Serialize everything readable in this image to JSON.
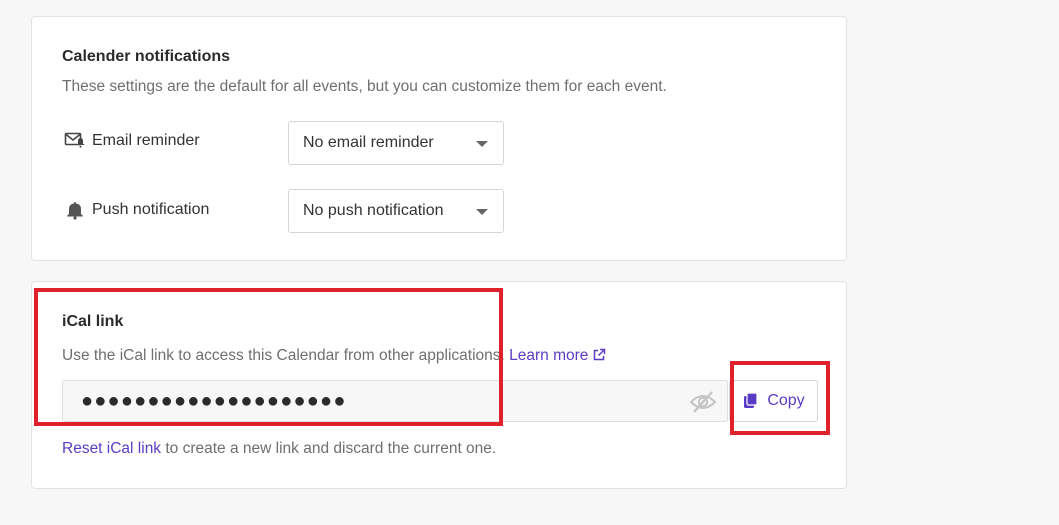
{
  "notifications": {
    "title": "Calender notifications",
    "description": "These settings are the default for all events, but you can customize them for each event.",
    "email": {
      "label": "Email reminder",
      "icon": "mail-bell-icon",
      "selected": "No email reminder"
    },
    "push": {
      "label": "Push notification",
      "icon": "bell-icon",
      "selected": "No push notification"
    }
  },
  "ical": {
    "title": "iCal link",
    "description": "Use the iCal link to access this Calendar from other applications.",
    "learn_more": "Learn more",
    "masked_value": "●●●●●●●●●●●●●●●●●●●●",
    "copy_label": "Copy",
    "reset_link": "Reset iCal link",
    "reset_suffix": " to create a new link and discard the current one."
  },
  "colors": {
    "accent": "#5b3cc4",
    "highlight": "#e0202a",
    "muted_text": "#6f6f6f",
    "border": "#e3e3e3"
  }
}
